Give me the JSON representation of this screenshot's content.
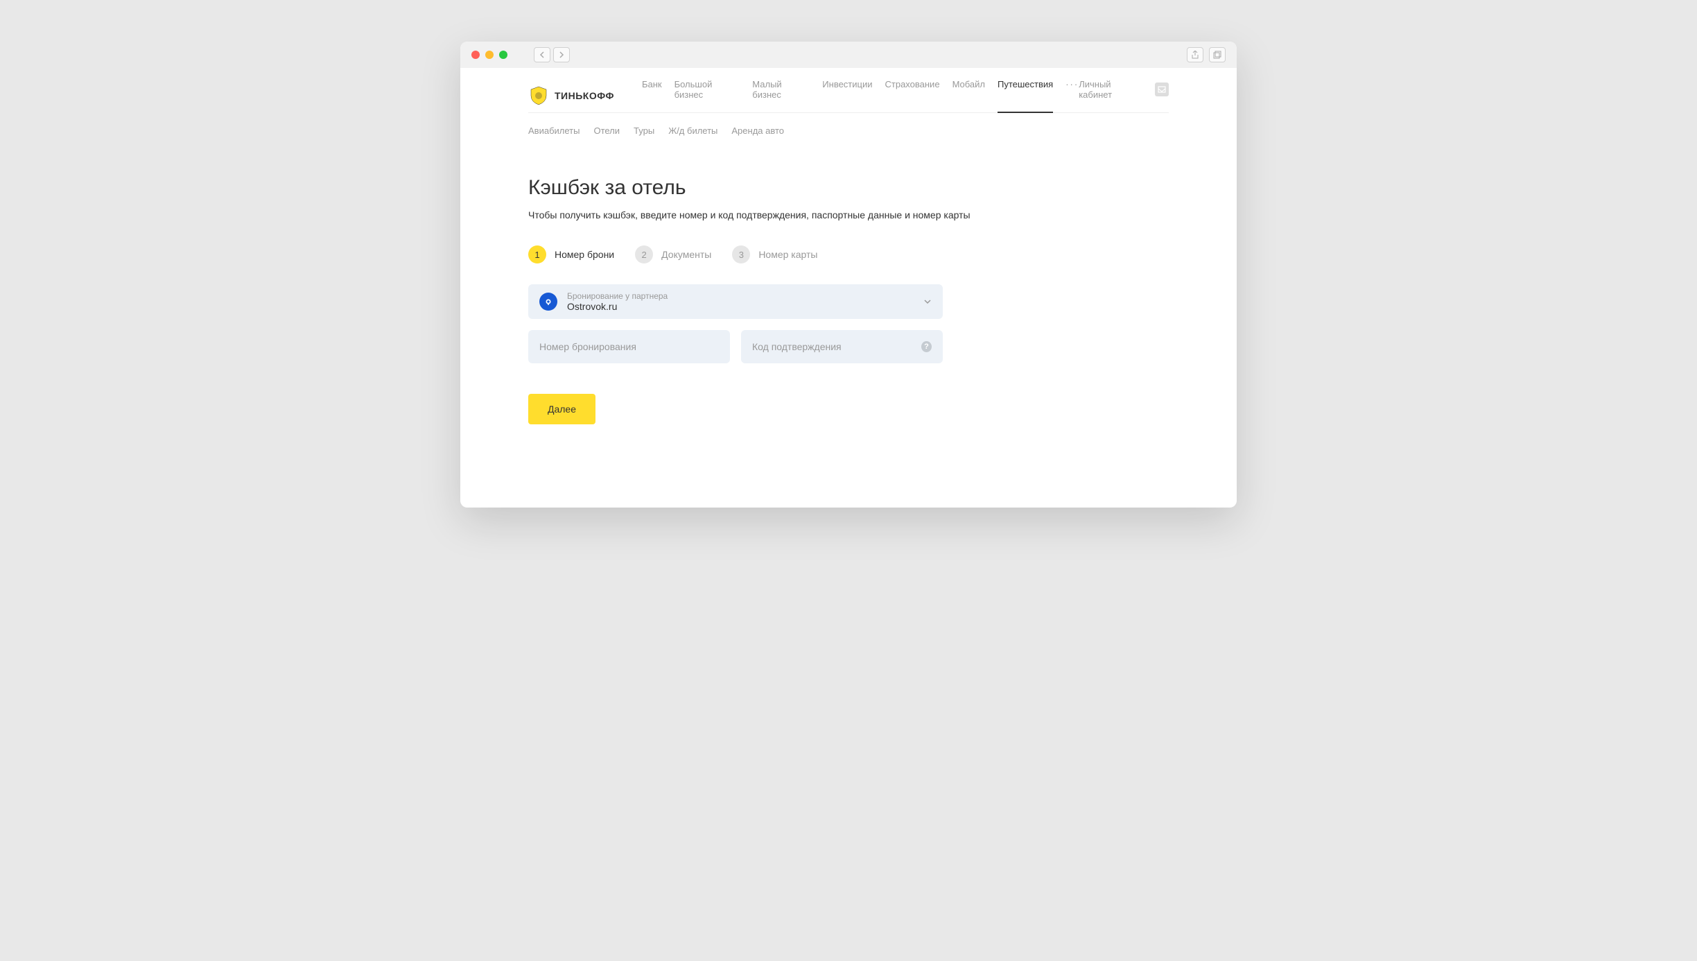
{
  "brand": "ТИНЬКОФФ",
  "mainnav": {
    "items": [
      {
        "label": "Банк"
      },
      {
        "label": "Большой бизнес"
      },
      {
        "label": "Малый бизнес"
      },
      {
        "label": "Инвестиции"
      },
      {
        "label": "Страхование"
      },
      {
        "label": "Мобайл"
      },
      {
        "label": "Путешествия"
      }
    ],
    "active_index": 6,
    "account_link": "Личный кабинет"
  },
  "subnav": {
    "items": [
      {
        "label": "Авиабилеты"
      },
      {
        "label": "Отели"
      },
      {
        "label": "Туры"
      },
      {
        "label": "Ж/д билеты"
      },
      {
        "label": "Аренда авто"
      }
    ]
  },
  "page": {
    "title": "Кэшбэк за отель",
    "subtitle": "Чтобы получить кэшбэк, введите номер и код подтверждения, паспортные данные и номер карты"
  },
  "stepper": {
    "steps": [
      {
        "num": "1",
        "label": "Номер брони"
      },
      {
        "num": "2",
        "label": "Документы"
      },
      {
        "num": "3",
        "label": "Номер карты"
      }
    ],
    "active_index": 0
  },
  "form": {
    "partner_label": "Бронирование у партнера",
    "partner_value": "Ostrovok.ru",
    "booking_number_placeholder": "Номер бронирования",
    "confirmation_code_placeholder": "Код подтверждения",
    "submit_label": "Далее"
  }
}
